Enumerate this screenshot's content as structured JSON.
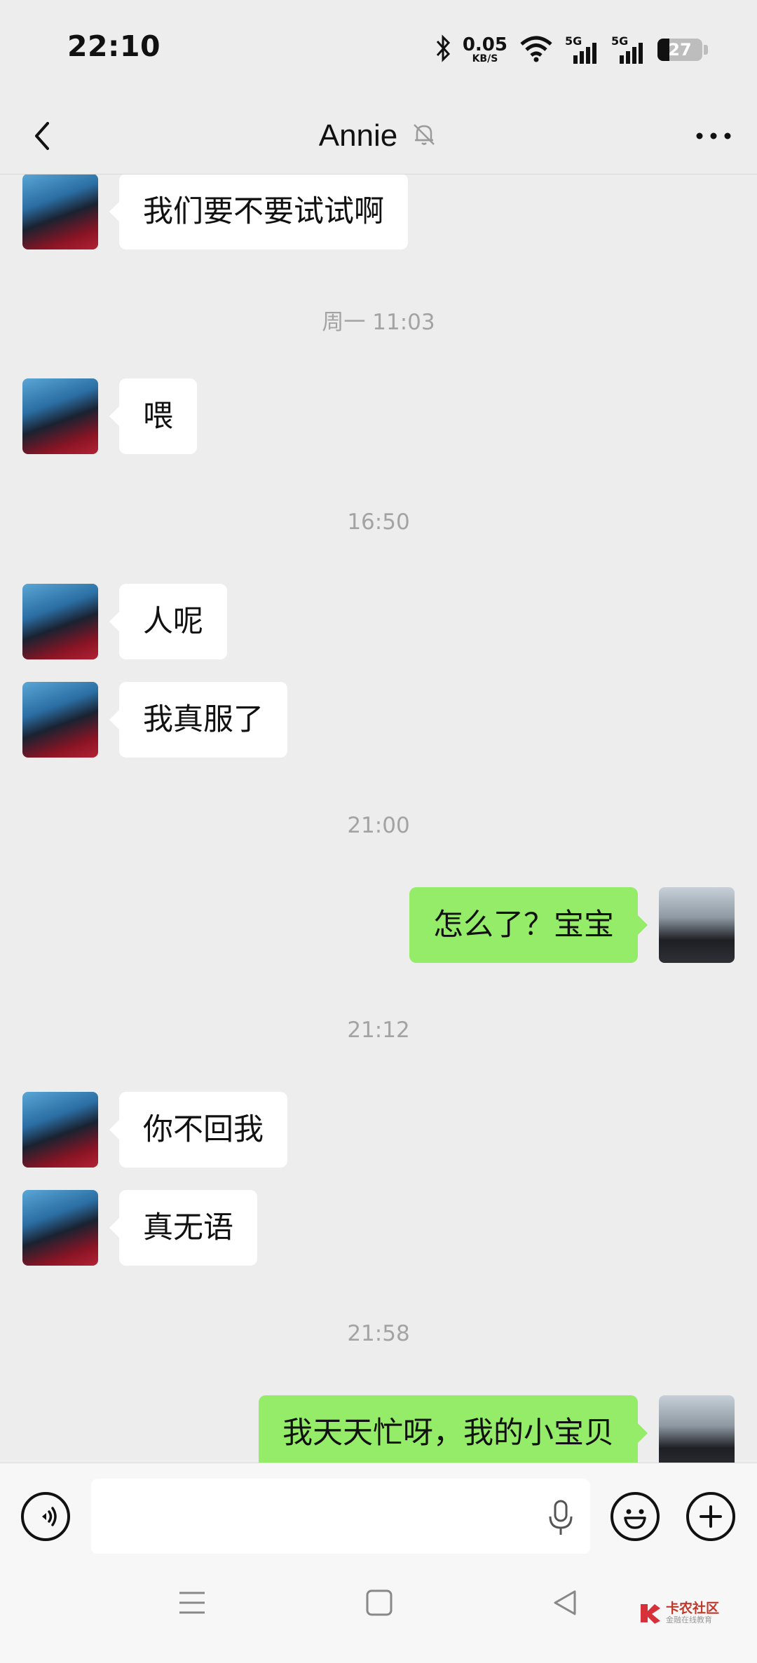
{
  "status_bar": {
    "time": "22:10",
    "net_speed": "0.05",
    "net_unit": "KB/S",
    "signal1_label": "5G",
    "signal2_label": "5G",
    "battery": "27",
    "battery_level": 0.27
  },
  "header": {
    "title": "Annie",
    "back_icon": "chevron-left-icon",
    "mute_icon": "bell-off-icon",
    "more_icon": "more-dots-icon"
  },
  "messages": [
    {
      "side": "left",
      "text": "我们要不要试试啊"
    },
    {
      "type": "time",
      "text": "周一 11:03"
    },
    {
      "side": "left",
      "text": "喂"
    },
    {
      "type": "time",
      "text": "16:50"
    },
    {
      "side": "left",
      "text": "人呢"
    },
    {
      "side": "left",
      "text": "我真服了"
    },
    {
      "type": "time",
      "text": "21:00"
    },
    {
      "side": "right",
      "text": "怎么了？宝宝"
    },
    {
      "type": "time",
      "text": "21:12"
    },
    {
      "side": "left",
      "text": "你不回我"
    },
    {
      "side": "left",
      "text": "真无语"
    },
    {
      "type": "time",
      "text": "21:58"
    },
    {
      "side": "right",
      "text": "我天天忙呀，我的小宝贝"
    }
  ],
  "input_bar": {
    "voice_icon": "voice-mode-icon",
    "mic_icon": "microphone-icon",
    "emoji_icon": "emoji-icon",
    "plus_icon": "plus-icon"
  },
  "system_nav": {
    "menu_icon": "menu-icon",
    "home_icon": "home-icon",
    "back_icon": "back-triangle-icon"
  },
  "watermark": {
    "title": "卡农社区",
    "subtitle": "金融在线教育"
  },
  "colors": {
    "background": "#ededed",
    "bubble_self": "#95ec69",
    "bubble_other": "#ffffff",
    "watermark_red": "#c0392b"
  }
}
